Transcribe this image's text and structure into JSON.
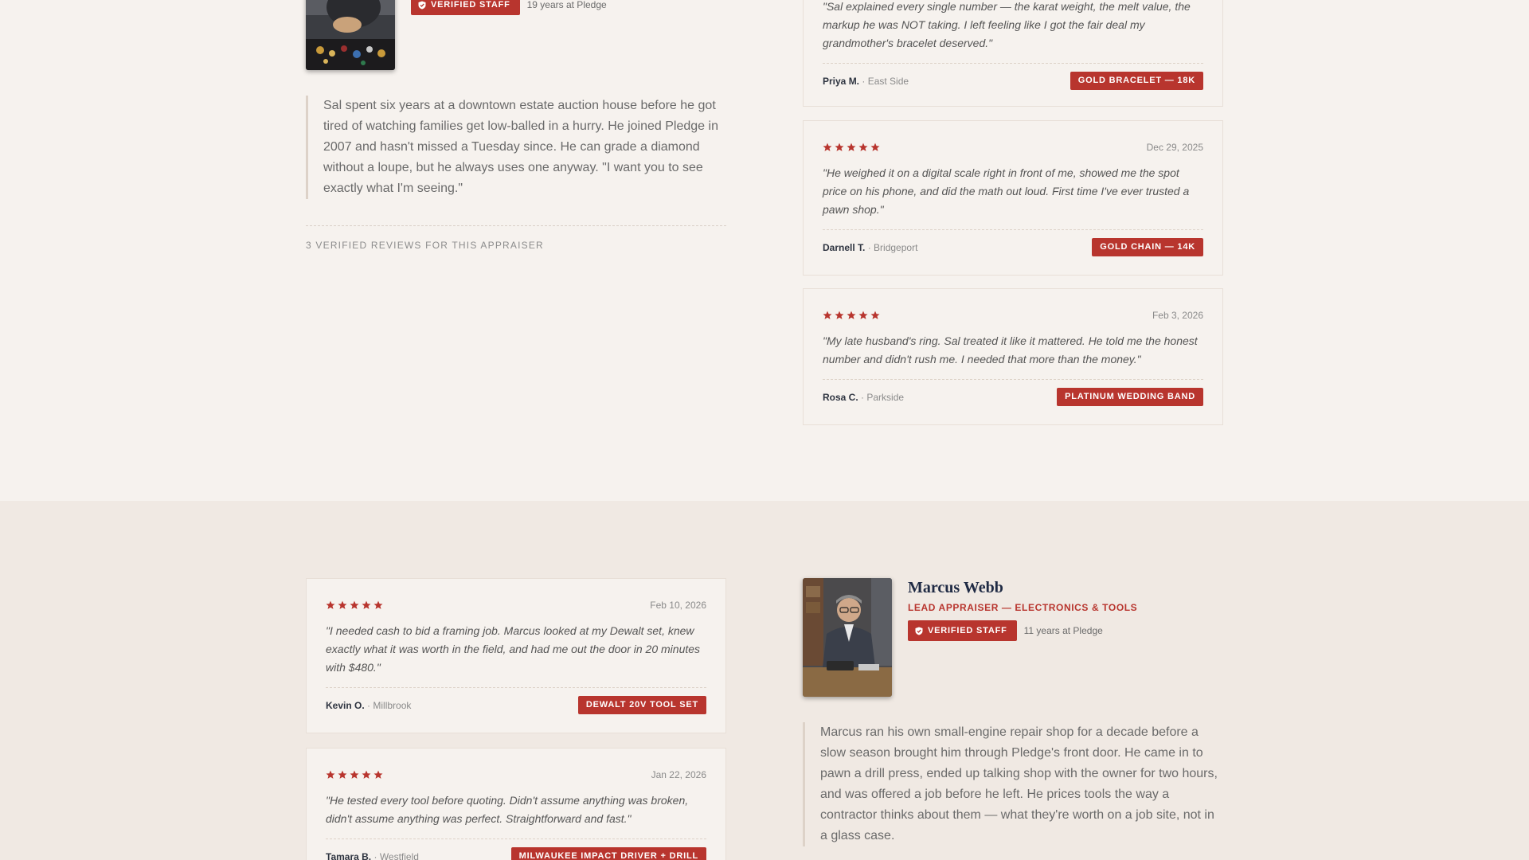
{
  "appraiser_sal": {
    "badge": "Verified Staff",
    "years": "19 years at Pledge",
    "bio": "Sal spent six years at a downtown estate auction house before he got tired of watching families get low-balled in a hurry. He joined Pledge in 2007 and hasn't missed a Tuesday since. He can grade a diamond without a loupe, but he always uses one anyway. \"I want you to see exactly what I'm seeing.\"",
    "review_count": "3 Verified Reviews for this Appraiser"
  },
  "sal_reviews": [
    {
      "quote": "\"Sal explained every single number — the karat weight, the melt value, the markup he was NOT taking. I left feeling like I got the fair deal my grandmother's bracelet deserved.\"",
      "name": "Priya M.",
      "location": "· East Side",
      "item": "Gold Bracelet — 18K"
    },
    {
      "rating": 5,
      "date": "Dec 29, 2025",
      "quote": "\"He weighed it on a digital scale right in front of me, showed me the spot price on his phone, and did the math out loud. First time I've ever trusted a pawn shop.\"",
      "name": "Darnell T.",
      "location": "· Bridgeport",
      "item": "Gold Chain — 14K"
    },
    {
      "rating": 5,
      "date": "Feb 3, 2026",
      "quote": "\"My late husband's ring. Sal treated it like it mattered. He told me the honest number and didn't rush me. I needed that more than the money.\"",
      "name": "Rosa C.",
      "location": "· Parkside",
      "item": "Platinum Wedding Band"
    }
  ],
  "appraiser_marcus": {
    "name": "Marcus Webb",
    "role": "Lead Appraiser — Electronics & Tools",
    "badge": "Verified Staff",
    "years": "11 years at Pledge",
    "bio": "Marcus ran his own small-engine repair shop for a decade before a slow season brought him through Pledge's front door. He came in to pawn a drill press, ended up talking shop with the owner for two hours, and was offered a job before he left. He prices tools the way a contractor thinks about them — what they're worth on a job site, not in a glass case."
  },
  "marcus_reviews": [
    {
      "rating": 5,
      "date": "Feb 10, 2026",
      "quote": "\"I needed cash to bid a framing job. Marcus looked at my Dewalt set, knew exactly what it was worth in the field, and had me out the door in 20 minutes with $480.\"",
      "name": "Kevin O.",
      "location": "· Millbrook",
      "item": "Dewalt 20V Tool Set"
    },
    {
      "rating": 5,
      "date": "Jan 22, 2026",
      "quote": "\"He tested every tool before quoting. Didn't assume anything was broken, didn't assume anything was perfect. Straightforward and fast.\"",
      "name": "Tamara B.",
      "location": "· Westfield",
      "item": "Milwaukee Impact Driver + Drill"
    }
  ],
  "colors": {
    "accent": "#b8352e",
    "navy": "#1f2a44",
    "bg_top": "#f6f2ee",
    "bg_bottom": "#f0e9e3"
  },
  "icons": {
    "badge": "shield-check-icon",
    "rating": "star-icon"
  }
}
